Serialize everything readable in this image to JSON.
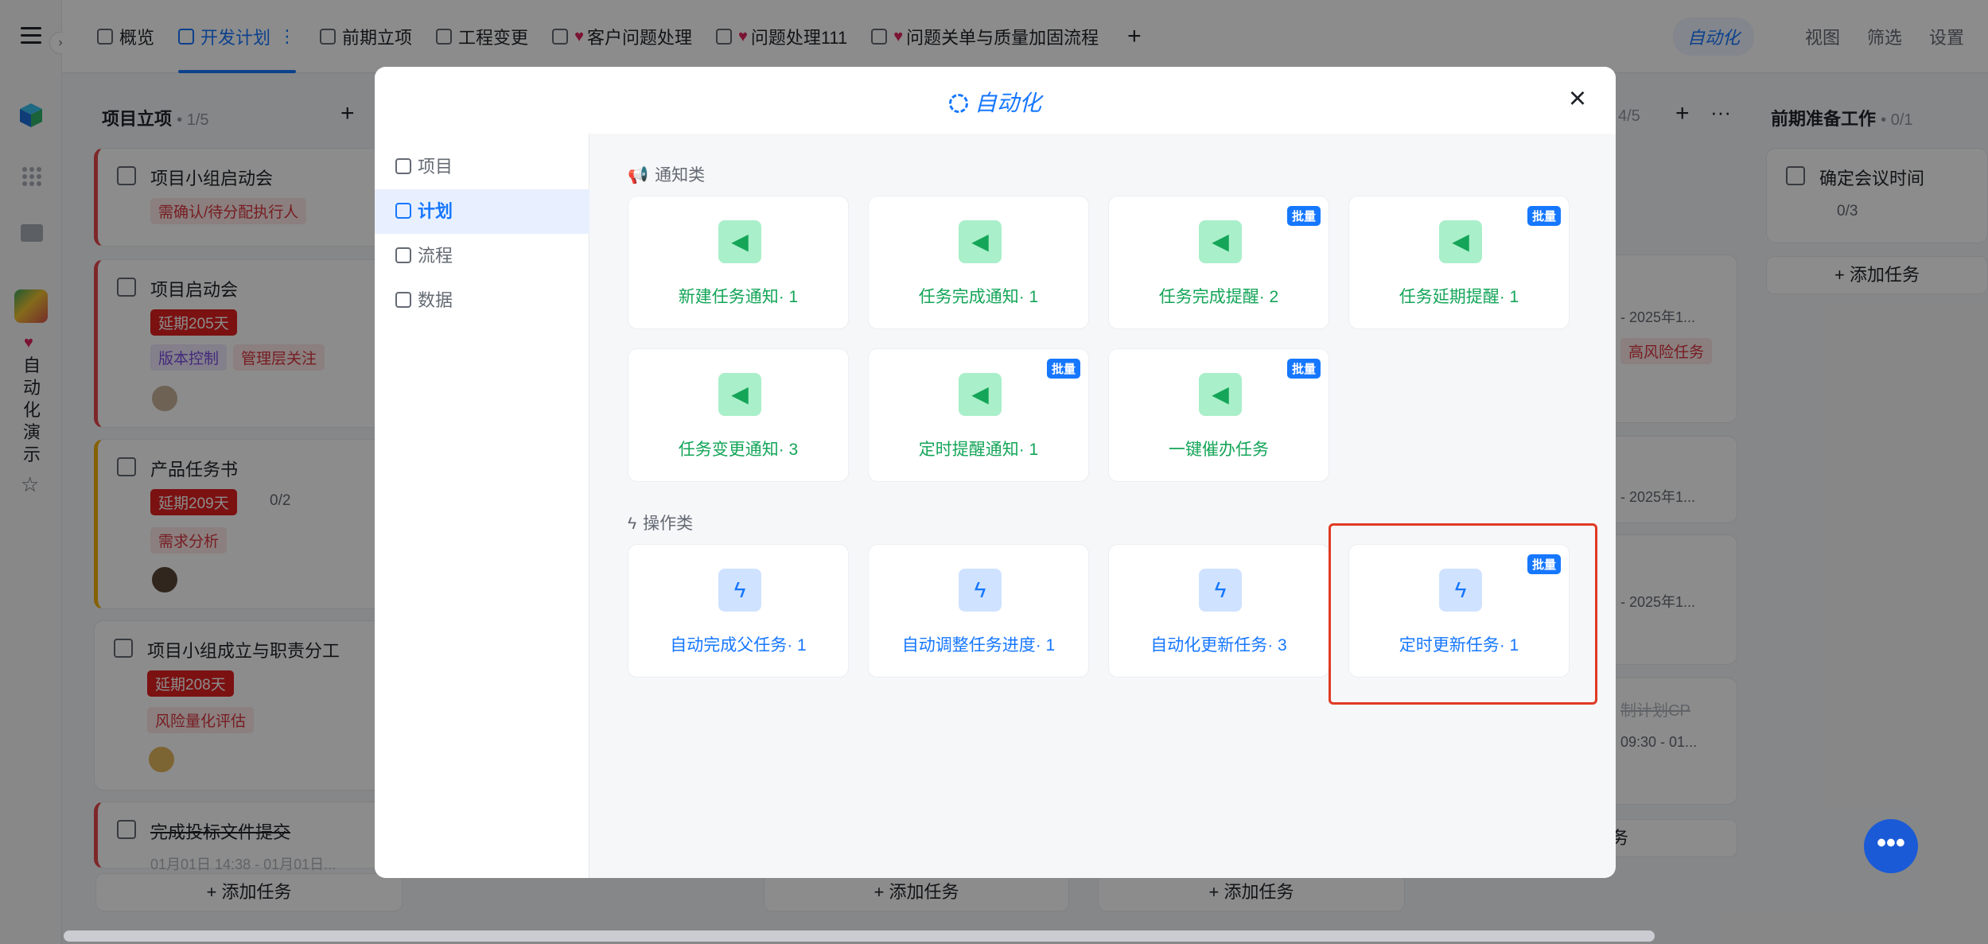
{
  "rail": {
    "app_vertical_title": [
      "自",
      "动",
      "化",
      "演",
      "示"
    ]
  },
  "tabs": [
    {
      "label": "概览",
      "active": false
    },
    {
      "label": "开发计划",
      "active": true
    },
    {
      "label": "前期立项",
      "active": false
    },
    {
      "label": "工程变更",
      "active": false
    },
    {
      "label": "客户问题处理",
      "active": false,
      "heart": true
    },
    {
      "label": "问题处理111",
      "active": false,
      "heart": true
    },
    {
      "label": "问题关单与质量加固流程",
      "active": false,
      "heart": true
    }
  ],
  "topbar": {
    "add": "+",
    "tab_more": "⋮",
    "automation": "自动化",
    "view": "视图",
    "filter": "筛选",
    "settings": "设置"
  },
  "board": {
    "col1": {
      "title": "项目立项",
      "count": "• 1/5",
      "add": "+",
      "cards": [
        {
          "title": "项目小组启动会",
          "tags": [
            "需确认/待分配执行人"
          ]
        },
        {
          "title": "项目启动会",
          "delay": "延期205天",
          "tags": [
            "版本控制",
            "管理层关注"
          ]
        },
        {
          "title": "产品任务书",
          "delay": "延期209天",
          "sub": "0/2",
          "tags": [
            "需求分析"
          ]
        },
        {
          "title": "项目小组成立与职责分工",
          "delay": "延期208天",
          "tags": [
            "风险量化评估"
          ]
        },
        {
          "title": "完成投标文件提交",
          "date": "01月01日 14:38 - 01月01日..."
        }
      ],
      "add_task": "添加任务"
    },
    "col_mid": {
      "count": "4/5",
      "add": "+",
      "more": "···",
      "date1": "- 2025年1...",
      "tag": "高风险任务",
      "date2": "- 2025年1...",
      "date3": "- 2025年1...",
      "faded_title": "制计划CP",
      "time": "09:30 - 01...",
      "tail": "务",
      "add_task_a": "添加任务",
      "add_task_b": "添加任务"
    },
    "col_last": {
      "title": "前期准备工作",
      "count": "• 0/1",
      "card_title": "确定会议时间",
      "sub": "0/3",
      "add_task": "添加任务"
    }
  },
  "modal": {
    "title": "自动化",
    "close": "×",
    "sidebar": [
      {
        "label": "项目",
        "active": false
      },
      {
        "label": "计划",
        "active": true
      },
      {
        "label": "流程",
        "active": false
      },
      {
        "label": "数据",
        "active": false
      }
    ],
    "sections": [
      {
        "label": "通知类",
        "items": [
          {
            "label": "新建任务通知· 1",
            "batch": false
          },
          {
            "label": "任务完成通知· 1",
            "batch": false
          },
          {
            "label": "任务完成提醒· 2",
            "batch": true
          },
          {
            "label": "任务延期提醒· 1",
            "batch": true
          },
          {
            "label": "任务变更通知· 3",
            "batch": false
          },
          {
            "label": "定时提醒通知· 1",
            "batch": true
          },
          {
            "label": "一键催办任务",
            "batch": true
          }
        ]
      },
      {
        "label": "操作类",
        "items": [
          {
            "label": "自动完成父任务· 1",
            "batch": false
          },
          {
            "label": "自动调整任务进度· 1",
            "batch": false
          },
          {
            "label": "自动化更新任务· 3",
            "batch": false
          },
          {
            "label": "定时更新任务· 1",
            "batch": true
          }
        ]
      }
    ],
    "batch_badge": "批量"
  },
  "colors": {
    "accent": "#1677ff",
    "notify_green": "#14a558",
    "highlight_red": "#e03a24"
  },
  "fab": "•••"
}
